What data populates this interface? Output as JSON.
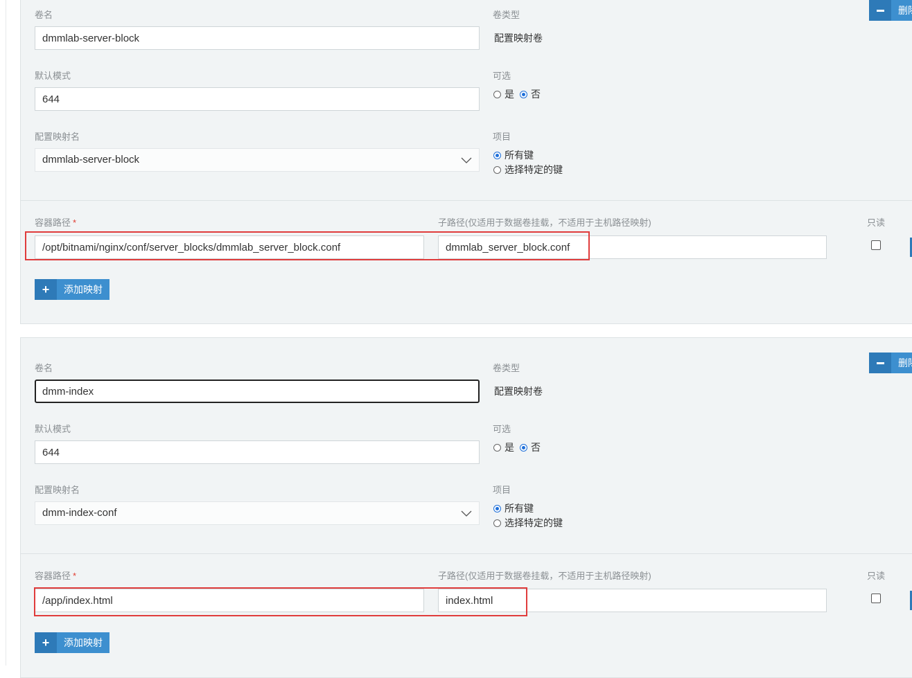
{
  "volumes": [
    {
      "volume_name_label": "卷名",
      "volume_name": "dmmlab-server-block",
      "volume_type_label": "卷类型",
      "volume_type": "配置映射卷",
      "default_mode_label": "默认模式",
      "default_mode": "644",
      "optional_label": "可选",
      "optional_yes": "是",
      "optional_no": "否",
      "optional_selected": "no",
      "configmap_name_label": "配置映射名",
      "configmap_name": "dmmlab-server-block",
      "items_label": "项目",
      "items_all_keys": "所有键",
      "items_specific_keys": "选择特定的键",
      "items_selected": "all",
      "delete_label": "删除",
      "container_path_label": "容器路径",
      "required_mark": "*",
      "container_path": "/opt/bitnami/nginx/conf/server_blocks/dmmlab_server_block.conf",
      "sub_path_label": "子路径(仅适用于数据卷挂载，不适用于主机路径映射)",
      "sub_path": "dmmlab_server_block.conf",
      "readonly_label": "只读",
      "readonly_checked": false,
      "add_mapping_label": "添加映射",
      "volume_name_focused": false
    },
    {
      "volume_name_label": "卷名",
      "volume_name": "dmm-index",
      "volume_type_label": "卷类型",
      "volume_type": "配置映射卷",
      "default_mode_label": "默认模式",
      "default_mode": "644",
      "optional_label": "可选",
      "optional_yes": "是",
      "optional_no": "否",
      "optional_selected": "no",
      "configmap_name_label": "配置映射名",
      "configmap_name": "dmm-index-conf",
      "items_label": "项目",
      "items_all_keys": "所有键",
      "items_specific_keys": "选择特定的键",
      "items_selected": "all",
      "delete_label": "删除",
      "container_path_label": "容器路径",
      "required_mark": "*",
      "container_path": "/app/index.html",
      "sub_path_label": "子路径(仅适用于数据卷挂载，不适用于主机路径映射)",
      "sub_path": "index.html",
      "readonly_label": "只读",
      "readonly_checked": false,
      "add_mapping_label": "添加映射",
      "volume_name_focused": true
    }
  ],
  "colors": {
    "accent": "#3d8fcf",
    "accent_dark": "#2e7ab8",
    "highlight": "#e03c3c",
    "required": "#e03c31",
    "panel_bg": "#f1f4f5"
  }
}
